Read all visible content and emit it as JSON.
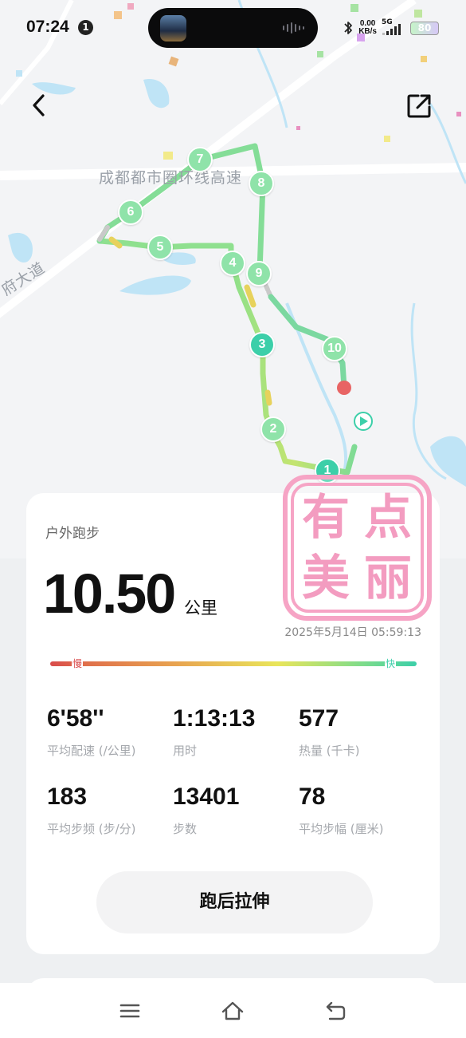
{
  "status_bar": {
    "time": "07:24",
    "notification_count": "1",
    "net_speed_value": "0.00",
    "net_speed_unit": "KB/s",
    "network": "5G",
    "battery": "80"
  },
  "map": {
    "road_label_ring": "成都都市圈环线高速",
    "road_label_avenue": "府大道",
    "km_markers": [
      "1",
      "2",
      "3",
      "4",
      "5",
      "6",
      "7",
      "8",
      "9",
      "10"
    ],
    "colors": {
      "route_fast": "#5dd5a0",
      "route_mid": "#9adf82",
      "end_point": "#e86464",
      "water": "#bfe4f6"
    }
  },
  "card": {
    "activity_type": "户外跑步",
    "distance": "10.50",
    "distance_unit": "公里",
    "date_time": "2025年5月14日 05:59:13",
    "pace_scale": {
      "slow": "慢",
      "fast": "快"
    },
    "stats": [
      {
        "value": "6'58''",
        "label": "平均配速 (/公里)"
      },
      {
        "value": "1:13:13",
        "label": "用时"
      },
      {
        "value": "577",
        "label": "热量 (千卡)"
      },
      {
        "value": "183",
        "label": "平均步频 (步/分)"
      },
      {
        "value": "13401",
        "label": "步数"
      },
      {
        "value": "78",
        "label": "平均步幅 (厘米)"
      }
    ],
    "stretch_button": "跑后拉伸"
  },
  "watermark": {
    "text": "有点美丽"
  },
  "icons": {
    "back": "chevron-left-icon",
    "share": "share-icon",
    "nav_menu": "menu-icon",
    "nav_home": "home-icon",
    "nav_back": "return-icon"
  }
}
